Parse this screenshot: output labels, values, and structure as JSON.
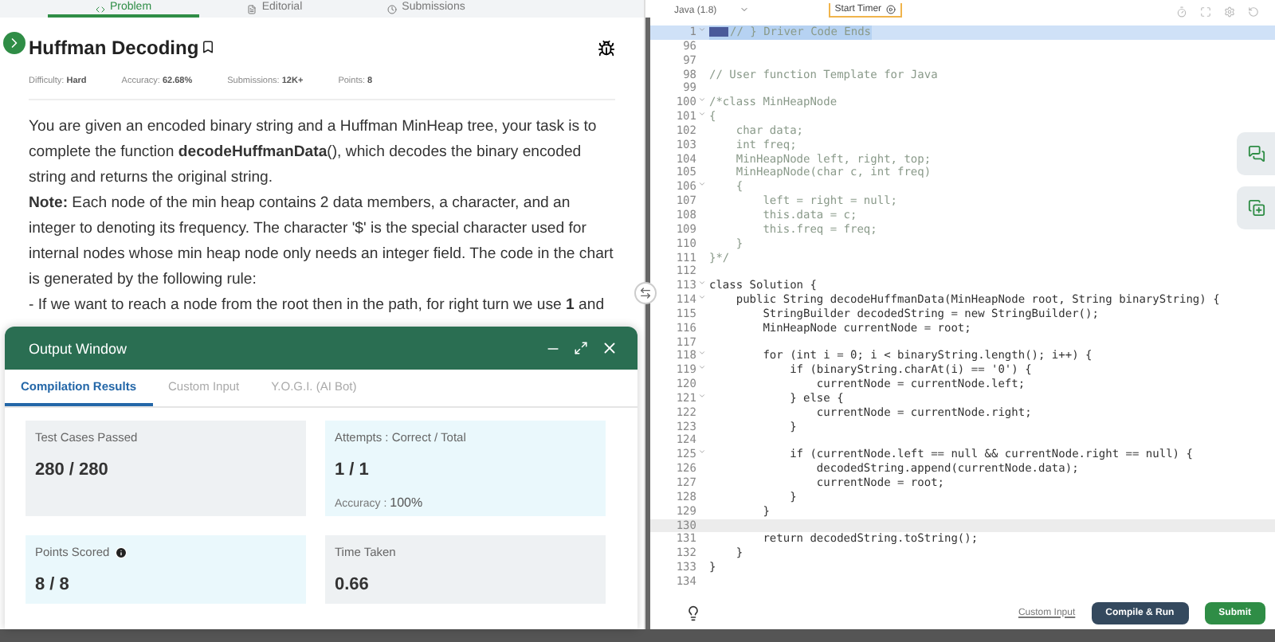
{
  "problem_tabs": [
    {
      "label": "Problem",
      "selected": true
    },
    {
      "label": "Editorial",
      "selected": false
    },
    {
      "label": "Submissions",
      "selected": false
    }
  ],
  "problem": {
    "title": "Huffman Decoding",
    "meta": [
      {
        "label": "Difficulty:",
        "value": "Hard"
      },
      {
        "label": "Accuracy:",
        "value": "62.68%"
      },
      {
        "label": "Submissions:",
        "value": "12K+"
      },
      {
        "label": "Points:",
        "value": "8"
      }
    ],
    "paragraphs": [
      "You are given an encoded binary string and a Huffman MinHeap tree, your task is to complete the function **decodeHuffmanData**(), which decodes the binary encoded string and returns the original string.",
      "**Note:** Each node of the min heap contains 2 data members, a character, and an integer to denoting its frequency. The character '$' is the special character used for internal nodes whose min heap node only needs an integer field. The code in the chart is generated by the following rule:",
      "- If we want to reach a node from the root then in the path, for right turn we use **1** and"
    ]
  },
  "output_window": {
    "title": "Output Window",
    "tabs": [
      {
        "label": "Compilation Results",
        "selected": true
      },
      {
        "label": "Custom Input",
        "selected": false
      },
      {
        "label": "Y.O.G.I. (AI Bot)",
        "selected": false
      }
    ],
    "cards": [
      {
        "label": "Test Cases Passed",
        "value": "280 / 280",
        "color": "#eef1f3"
      },
      {
        "label": "Attempts : Correct / Total",
        "value": "1 / 1",
        "note_label": "Accuracy :",
        "note_value": "100%",
        "color": "#eaf8fc"
      },
      {
        "label": "Points Scored",
        "value": "8 / 8",
        "info": true,
        "color": "#eaf8fc"
      },
      {
        "label": "Time Taken",
        "value": "0.66",
        "color": "#eef1f3"
      }
    ]
  },
  "editor": {
    "language": "Java (1.8)",
    "timer_button": "Start Timer",
    "lines": [
      {
        "number": "1",
        "fold": true,
        "selected": true,
        "current": false,
        "kind": "comment",
        "text": "// } Driver Code Ends"
      },
      {
        "number": "96",
        "fold": false,
        "selected": false,
        "current": false
      },
      {
        "number": "97",
        "fold": false,
        "selected": false,
        "current": false
      },
      {
        "number": "98",
        "fold": false,
        "selected": false,
        "current": false,
        "kind": "comment",
        "text": "// User function Template for Java"
      },
      {
        "number": "99",
        "fold": false,
        "selected": false,
        "current": false
      },
      {
        "number": "100",
        "fold": true,
        "selected": false,
        "current": false,
        "kind": "comment",
        "text": "/*class MinHeapNode"
      },
      {
        "number": "101",
        "fold": true,
        "selected": false,
        "current": false,
        "kind": "comment",
        "text": "{"
      },
      {
        "number": "102",
        "fold": false,
        "selected": false,
        "current": false,
        "kind": "comment",
        "text": "    char data;"
      },
      {
        "number": "103",
        "fold": false,
        "selected": false,
        "current": false,
        "kind": "comment",
        "text": "    int freq;"
      },
      {
        "number": "104",
        "fold": false,
        "selected": false,
        "current": false,
        "kind": "comment",
        "text": "    MinHeapNode left, right, top;"
      },
      {
        "number": "105",
        "fold": false,
        "selected": false,
        "current": false,
        "kind": "comment",
        "text": "    MinHeapNode(char c, int freq)"
      },
      {
        "number": "106",
        "fold": true,
        "selected": false,
        "current": false,
        "kind": "comment",
        "text": "    {"
      },
      {
        "number": "107",
        "fold": false,
        "selected": false,
        "current": false,
        "kind": "comment",
        "text": "        left = right = null;"
      },
      {
        "number": "108",
        "fold": false,
        "selected": false,
        "current": false,
        "kind": "comment",
        "text": "        this.data = c;"
      },
      {
        "number": "109",
        "fold": false,
        "selected": false,
        "current": false,
        "kind": "comment",
        "text": "        this.freq = freq;"
      },
      {
        "number": "110",
        "fold": false,
        "selected": false,
        "current": false,
        "kind": "comment",
        "text": "    }"
      },
      {
        "number": "111",
        "fold": false,
        "selected": false,
        "current": false,
        "kind": "comment",
        "text": "}*/"
      },
      {
        "number": "112",
        "fold": false,
        "selected": false,
        "current": false
      },
      {
        "number": "113",
        "fold": true,
        "selected": false,
        "current": false,
        "kind": "code",
        "text": "class Solution {"
      },
      {
        "number": "114",
        "fold": true,
        "selected": false,
        "current": false,
        "kind": "code",
        "text": "    public String decodeHuffmanData(MinHeapNode root, String binaryString) {"
      },
      {
        "number": "115",
        "fold": false,
        "selected": false,
        "current": false,
        "kind": "code",
        "text": "        StringBuilder decodedString = new StringBuilder();"
      },
      {
        "number": "116",
        "fold": false,
        "selected": false,
        "current": false,
        "kind": "code",
        "text": "        MinHeapNode currentNode = root;"
      },
      {
        "number": "117",
        "fold": false,
        "selected": false,
        "current": false
      },
      {
        "number": "118",
        "fold": true,
        "selected": false,
        "current": false,
        "kind": "code",
        "text": "        for (int i = 0; i < binaryString.length(); i++) {"
      },
      {
        "number": "119",
        "fold": true,
        "selected": false,
        "current": false,
        "kind": "code",
        "text": "            if (binaryString.charAt(i) == '0') {"
      },
      {
        "number": "120",
        "fold": false,
        "selected": false,
        "current": false,
        "kind": "code",
        "text": "                currentNode = currentNode.left;"
      },
      {
        "number": "121",
        "fold": true,
        "selected": false,
        "current": false,
        "kind": "code",
        "text": "            } else {"
      },
      {
        "number": "122",
        "fold": false,
        "selected": false,
        "current": false,
        "kind": "code",
        "text": "                currentNode = currentNode.right;"
      },
      {
        "number": "123",
        "fold": false,
        "selected": false,
        "current": false,
        "kind": "code",
        "text": "            }"
      },
      {
        "number": "124",
        "fold": false,
        "selected": false,
        "current": false
      },
      {
        "number": "125",
        "fold": true,
        "selected": false,
        "current": false,
        "kind": "code",
        "text": "            if (currentNode.left == null && currentNode.right == null) {"
      },
      {
        "number": "126",
        "fold": false,
        "selected": false,
        "current": false,
        "kind": "code",
        "text": "                decodedString.append(currentNode.data);"
      },
      {
        "number": "127",
        "fold": false,
        "selected": false,
        "current": false,
        "kind": "code",
        "text": "                currentNode = root;"
      },
      {
        "number": "128",
        "fold": false,
        "selected": false,
        "current": false,
        "kind": "code",
        "text": "            }"
      },
      {
        "number": "129",
        "fold": false,
        "selected": false,
        "current": false,
        "kind": "code",
        "text": "        }"
      },
      {
        "number": "130",
        "fold": false,
        "selected": false,
        "current": true
      },
      {
        "number": "131",
        "fold": false,
        "selected": false,
        "current": false,
        "kind": "code",
        "text": "        return decodedString.toString();"
      },
      {
        "number": "132",
        "fold": false,
        "selected": false,
        "current": false,
        "kind": "code",
        "text": "    }"
      },
      {
        "number": "133",
        "fold": false,
        "selected": false,
        "current": false,
        "kind": "code",
        "text": "}"
      },
      {
        "number": "134",
        "fold": false,
        "selected": false,
        "current": false
      }
    ],
    "custom_input_link": "Custom Input",
    "compile_button": "Compile & Run",
    "submit_button": "Submit"
  }
}
